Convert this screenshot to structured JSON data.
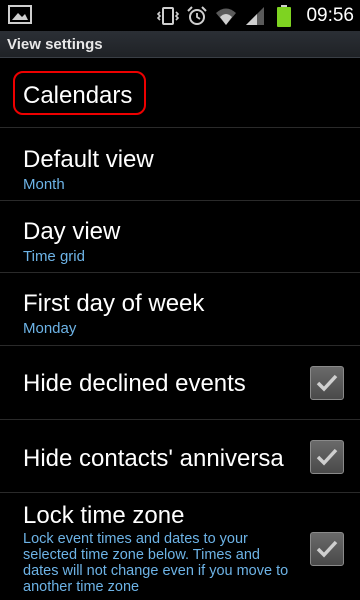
{
  "status_bar": {
    "time": "09:56",
    "icons": [
      "image-icon",
      "vibrate-icon",
      "alarm-icon",
      "wifi-icon",
      "signal-icon",
      "battery-icon"
    ]
  },
  "title_bar": {
    "title": "View settings"
  },
  "settings": [
    {
      "label": "Calendars"
    },
    {
      "label": "Default view",
      "value": "Month"
    },
    {
      "label": "Day view",
      "value": "Time grid"
    },
    {
      "label": "First day of week",
      "value": "Monday"
    },
    {
      "label": "Hide declined events",
      "checked": true
    },
    {
      "label": "Hide contacts' anniversa",
      "checked": true
    },
    {
      "label": "Lock time zone",
      "description": "Lock event times and dates to your selected time zone below. Times and dates will not change even if you move to another time zone",
      "checked": true
    }
  ],
  "colors": {
    "accent": "#6db3e6",
    "highlight": "#e00000",
    "battery": "#7ed321"
  }
}
